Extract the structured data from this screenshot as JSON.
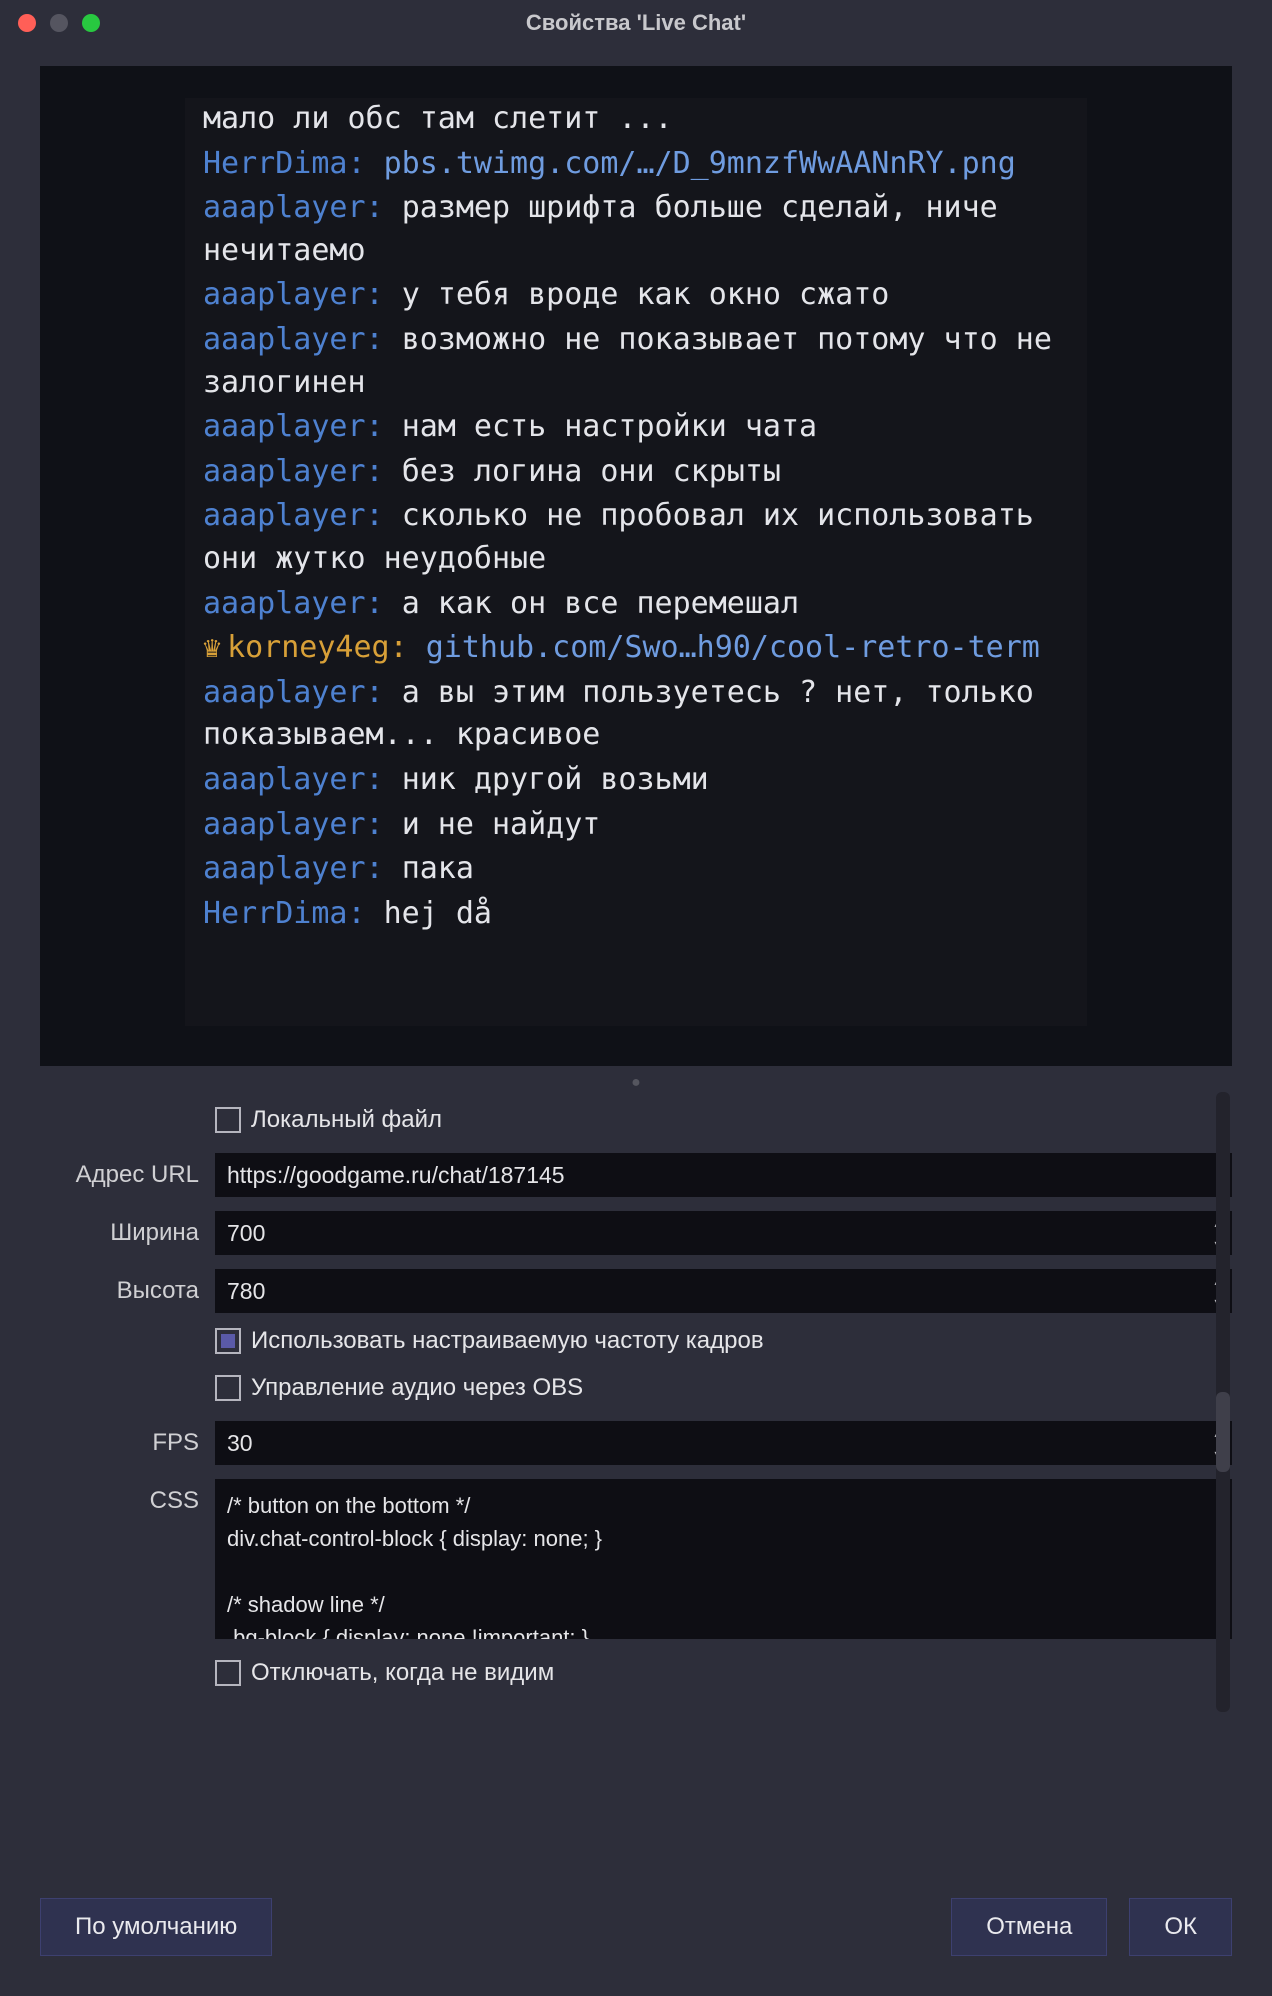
{
  "window": {
    "title": "Свойства 'Live Chat'"
  },
  "chat": {
    "messages": [
      {
        "nick": "",
        "text": "мало ли обс там слетит ..."
      },
      {
        "nick": "HerrDima",
        "nickClass": "nick",
        "text": "",
        "isLink": true,
        "link": "pbs.twimg.com/…/D_9mnzfWwAANnRY.png"
      },
      {
        "nick": "aaaplayer",
        "nickClass": "nick",
        "text": "размер шрифта больше сделай, ниче нечитаемо"
      },
      {
        "nick": "aaaplayer",
        "nickClass": "nick",
        "text": "у тебя вроде как окно сжато"
      },
      {
        "nick": "aaaplayer",
        "nickClass": "nick",
        "text": "возможно не показывает потому что не залогинен"
      },
      {
        "nick": "aaaplayer",
        "nickClass": "nick",
        "text": "нам есть настройки чата"
      },
      {
        "nick": "aaaplayer",
        "nickClass": "nick",
        "text": "без логина они скрыты"
      },
      {
        "nick": "aaaplayer",
        "nickClass": "nick",
        "text": "сколько не пробовал их использовать они жутко неудобные"
      },
      {
        "nick": "aaaplayer",
        "nickClass": "nick",
        "text": "а как он все перемешал"
      },
      {
        "nick": "korney4eg",
        "nickClass": "nick-crown",
        "crown": true,
        "text": "",
        "isLink": true,
        "link": "github.com/Swo…h90/cool-retro-term"
      },
      {
        "nick": "aaaplayer",
        "nickClass": "nick",
        "text": "а вы этим пользуетесь ? нет, только показываем... красивое"
      },
      {
        "nick": "aaaplayer",
        "nickClass": "nick",
        "text": "ник другой возьми"
      },
      {
        "nick": "aaaplayer",
        "nickClass": "nick",
        "text": "и не найдут"
      },
      {
        "nick": "aaaplayer",
        "nickClass": "nick",
        "text": "пака"
      },
      {
        "nick": "HerrDima",
        "nickClass": "nick",
        "text": "hej då"
      }
    ]
  },
  "form": {
    "local_file_label": "Локальный файл",
    "url_label": "Адрес URL",
    "url_value": "https://goodgame.ru/chat/187145",
    "width_label": "Ширина",
    "width_value": "700",
    "height_label": "Высота",
    "height_value": "780",
    "custom_fps_label": "Использовать настраиваемую частоту кадров",
    "custom_fps_checked": true,
    "audio_obs_label": "Управление аудио через OBS",
    "fps_label": "FPS",
    "fps_value": "30",
    "css_label": "CSS",
    "css_value": "/* button on the bottom */\ndiv.chat-control-block { display: none; }\n\n/* shadow line */\n.bg-block { display: none !important; }\n\n/* chat height */",
    "shutdown_label": "Отключать, когда не видим"
  },
  "buttons": {
    "defaults": "По умолчанию",
    "cancel": "Отмена",
    "ok": "ОК"
  }
}
